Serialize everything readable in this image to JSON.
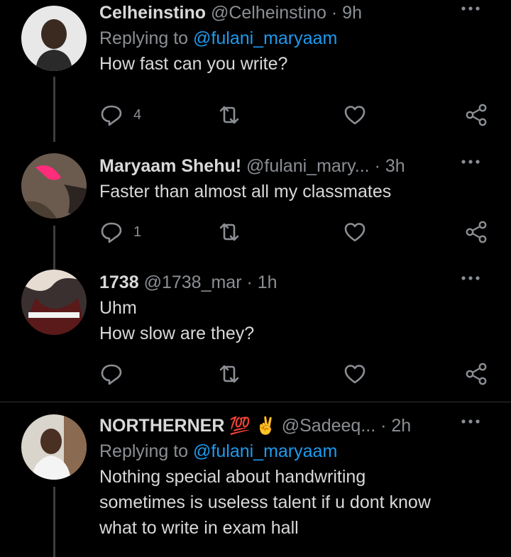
{
  "tweets": [
    {
      "name": "Celheinstino",
      "handle": "@Celheinstino",
      "dot": "·",
      "time": "9h",
      "replying_prefix": "Replying to ",
      "replying_to": "@fulani_maryaam",
      "lines": [
        "How fast can you write?"
      ],
      "reply_count": "4",
      "retweet_count": "",
      "like_count": ""
    },
    {
      "name": "Maryaam Shehu!",
      "handle": "@fulani_mary...",
      "dot": "·",
      "time": "3h",
      "lines": [
        "Faster than almost all my classmates"
      ],
      "reply_count": "1",
      "retweet_count": "",
      "like_count": ""
    },
    {
      "name": "1738",
      "handle": "@1738_mar",
      "dot": "·",
      "time": "1h",
      "lines": [
        "Uhm",
        "How slow are they?"
      ],
      "reply_count": "",
      "retweet_count": "",
      "like_count": ""
    },
    {
      "name": "NORTHERNER",
      "emojis": "💯 ✌",
      "handle": "@Sadeeq...",
      "dot": "·",
      "time": "2h",
      "replying_prefix": "Replying to ",
      "replying_to": "@fulani_maryaam",
      "lines": [
        "Nothing special about handwriting",
        "sometimes is useless talent if u dont know",
        "what to write in exam hall"
      ]
    }
  ],
  "colors": {
    "background": "#000000",
    "text": "#d9d9d9",
    "muted": "#8b8f94",
    "link": "#1d9bf0",
    "thread_line": "#3d3d3d"
  },
  "icons": [
    "reply-icon",
    "retweet-icon",
    "like-icon",
    "share-icon",
    "more-icon"
  ]
}
